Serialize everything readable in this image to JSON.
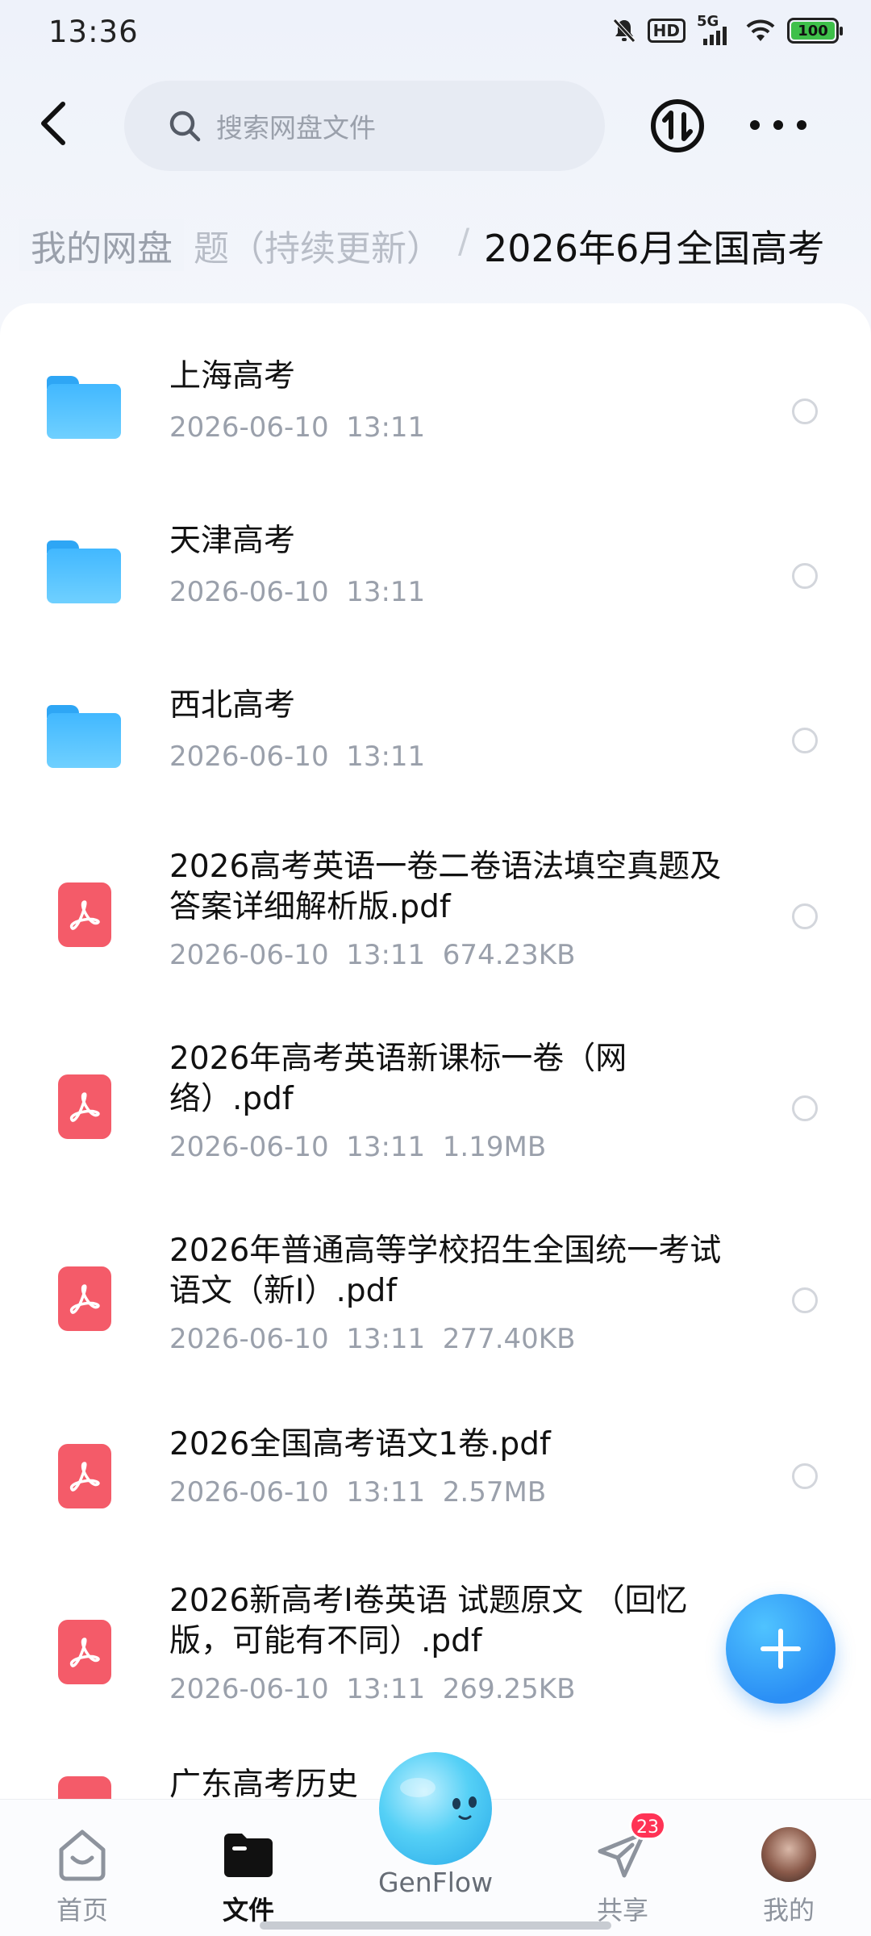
{
  "status_bar": {
    "time": "13:36",
    "hd": "HD",
    "network": "5G",
    "battery": "100"
  },
  "header": {
    "search_placeholder": "搜索网盘文件"
  },
  "breadcrumb": {
    "root": "我的网盘",
    "middle": "题（持续更新）",
    "separator": "/",
    "current": "2026年6月全国高考"
  },
  "files": [
    {
      "type": "folder",
      "name": "上海高考",
      "meta": "2026-06-10  13:11"
    },
    {
      "type": "folder",
      "name": "天津高考",
      "meta": "2026-06-10  13:11"
    },
    {
      "type": "folder",
      "name": "西北高考",
      "meta": "2026-06-10  13:11"
    },
    {
      "type": "pdf",
      "name": "2026高考英语一卷二卷语法填空真题及答案详细解析版.pdf",
      "meta": "2026-06-10  13:11  674.23KB"
    },
    {
      "type": "pdf",
      "name": "2026年高考英语新课标一卷（网络）.pdf",
      "meta": "2026-06-10  13:11  1.19MB"
    },
    {
      "type": "pdf",
      "name": "2026年普通高等学校招生全国统一考试语文（新I）.pdf",
      "meta": "2026-06-10  13:11  277.40KB"
    },
    {
      "type": "pdf",
      "name": "2026全国高考语文1卷.pdf",
      "meta": "2026-06-10  13:11  2.57MB"
    },
    {
      "type": "pdf",
      "name": "2026新高考Ⅰ卷英语 试题原文 （回忆版，可能有不同）.pdf",
      "meta": "2026-06-10  13:11  269.25KB"
    },
    {
      "type": "pdf",
      "name": "广东高考历史",
      "meta": ""
    }
  ],
  "bottom_nav": {
    "home": "首页",
    "files": "文件",
    "genflow": "GenFlow",
    "share": "共享",
    "share_badge": "23",
    "mine": "我的"
  }
}
